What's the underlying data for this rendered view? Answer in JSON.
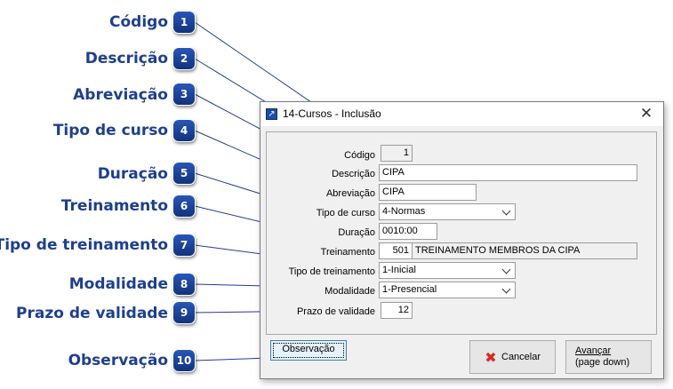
{
  "callouts": [
    {
      "number": "1",
      "label": "Código"
    },
    {
      "number": "2",
      "label": "Descrição"
    },
    {
      "number": "3",
      "label": "Abreviação"
    },
    {
      "number": "4",
      "label": "Tipo de curso"
    },
    {
      "number": "5",
      "label": "Duração"
    },
    {
      "number": "6",
      "label": "Treinamento"
    },
    {
      "number": "7",
      "label": "Tipo de treinamento"
    },
    {
      "number": "8",
      "label": "Modalidade"
    },
    {
      "number": "9",
      "label": "Prazo de validade"
    },
    {
      "number": "10",
      "label": "Observação"
    }
  ],
  "dialog": {
    "title": "14-Cursos - Inclusão",
    "close_icon": "close-icon",
    "fields": {
      "codigo": {
        "label": "Código",
        "value": "1"
      },
      "descricao": {
        "label": "Descrição",
        "value": "CIPA"
      },
      "abreviacao": {
        "label": "Abreviação",
        "value": "CIPA"
      },
      "tipo_curso": {
        "label": "Tipo de curso",
        "value": "4-Normas"
      },
      "duracao": {
        "label": "Duração",
        "value": "0010:00"
      },
      "treinamento": {
        "label": "Treinamento",
        "code": "501",
        "name": "TREINAMENTO MEMBROS DA CIPA"
      },
      "tipo_treinamento": {
        "label": "Tipo de treinamento",
        "value": "1-Inicial"
      },
      "modalidade": {
        "label": "Modalidade",
        "value": "1-Presencial"
      },
      "prazo_validade": {
        "label": "Prazo de validade",
        "value": "12"
      }
    },
    "buttons": {
      "observacao": "Observação",
      "cancelar": "Cancelar",
      "avancar_line1": "Avançar",
      "avancar_line2": "(page down)"
    }
  },
  "colors": {
    "callout_text": "#1e3f8e",
    "badge": "#1a3f96",
    "cancel_icon": "#d62b1f",
    "next_icon": "#3aa82a"
  }
}
